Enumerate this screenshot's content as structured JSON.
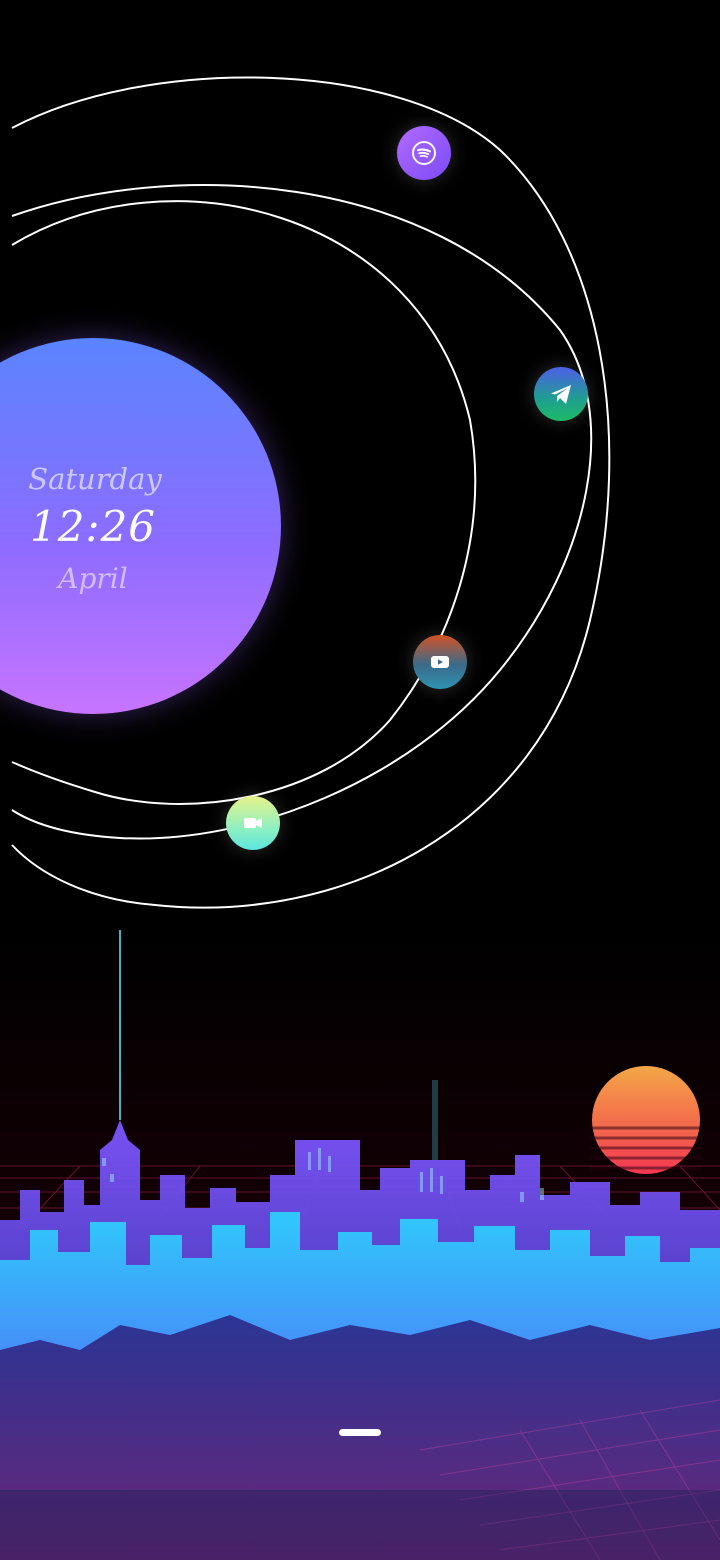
{
  "lockscreen": {
    "day": "Saturday",
    "time": "12:26",
    "month": "April"
  },
  "orbit_apps": [
    {
      "name": "Spotify",
      "icon": "spotify-icon"
    },
    {
      "name": "Telegram",
      "icon": "telegram-icon"
    },
    {
      "name": "YouTube",
      "icon": "youtube-icon"
    },
    {
      "name": "Video call",
      "icon": "video-camera-icon"
    }
  ],
  "colors": {
    "background": "#000000",
    "planet_top": "#5a84ff",
    "planet_bottom": "#c774ff",
    "orbit_line": "#ffffff",
    "city_neon": "#29d8ff",
    "sun": "#ff8a3d"
  }
}
